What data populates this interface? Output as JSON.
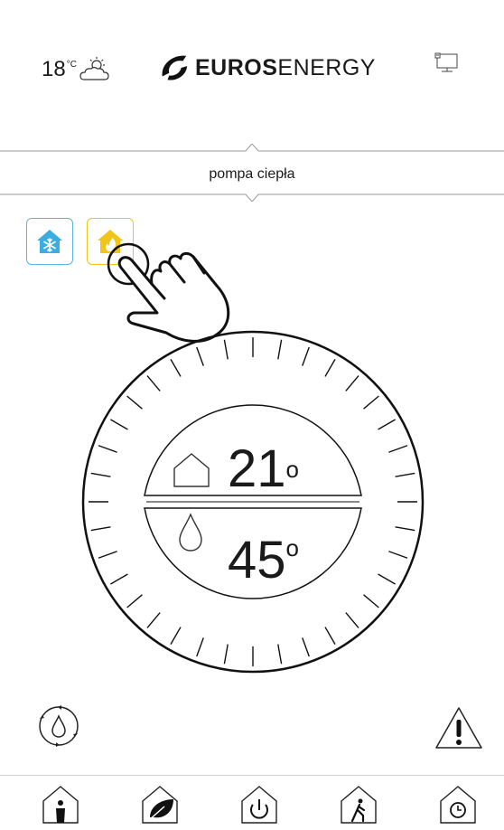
{
  "header": {
    "outside_temp": "18",
    "temp_unit": "°C",
    "weather_icon": "partly-cloudy-icon",
    "brand_bold": "EUROS",
    "brand_light": "ENERGY",
    "device_icon": "monitor-icon"
  },
  "section": {
    "title": "pompa ciepła"
  },
  "modes": [
    {
      "name": "cooling",
      "icon": "snowflake-house-icon",
      "color": "#3aaee0",
      "active": false
    },
    {
      "name": "heating",
      "icon": "flame-house-icon",
      "color": "#f0c419",
      "active": true
    }
  ],
  "dial": {
    "room_temp": "21",
    "water_temp": "45",
    "degree_symbol": "o",
    "room_icon": "house-icon",
    "water_icon": "water-drop-icon"
  },
  "actions": {
    "left_icon": "water-cycle-icon",
    "right_icon": "warning-icon"
  },
  "nav": [
    {
      "icon": "home-person-icon"
    },
    {
      "icon": "eco-leaf-house-icon"
    },
    {
      "icon": "power-house-icon"
    },
    {
      "icon": "away-walking-house-icon"
    },
    {
      "icon": "schedule-clock-house-icon"
    }
  ],
  "colors": {
    "accent_blue": "#3aaee0",
    "accent_yellow": "#f0c419",
    "line": "#222222"
  }
}
